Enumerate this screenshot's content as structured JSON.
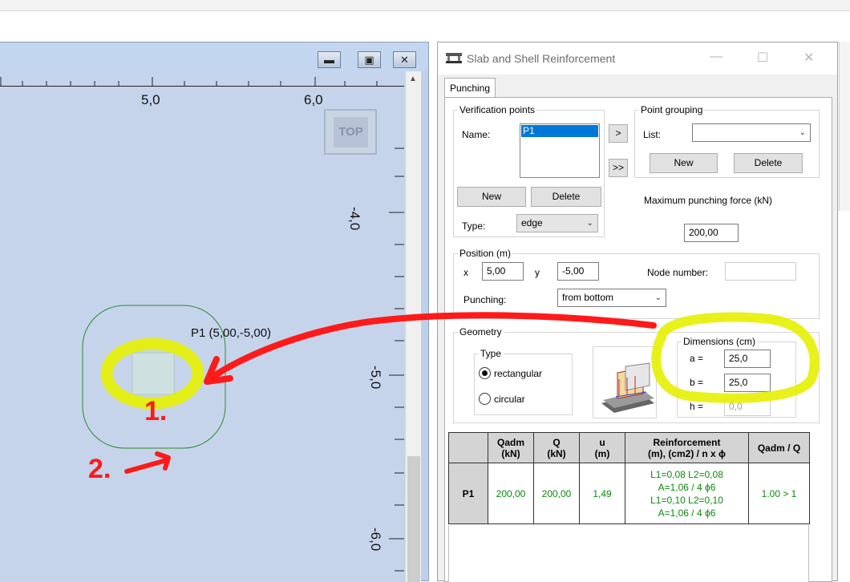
{
  "viewport": {
    "ruler_top": [
      "5,0",
      "6,0"
    ],
    "ruler_right": [
      "-4,0",
      "-5,0",
      "-6,0"
    ],
    "cube_label": "TOP",
    "point_label": "P1 (5,00,-5,00)"
  },
  "dialog": {
    "title": "Slab and Shell Reinforcement",
    "tab": "Punching",
    "verification": {
      "legend": "Verification points",
      "name_label": "Name:",
      "list_items": [
        "P1"
      ],
      "new_label": "New",
      "delete_label": "Delete",
      "type_label": "Type:",
      "type_value": "edge"
    },
    "move_one": ">",
    "move_all": ">>",
    "grouping": {
      "legend": "Point grouping",
      "list_label": "List:",
      "list_value": "",
      "new_label": "New",
      "delete_label": "Delete"
    },
    "max_force_label": "Maximum punching force (kN)",
    "max_force_value": "200,00",
    "position": {
      "legend": "Position (m)",
      "x_label": "x",
      "x_value": "5,00",
      "y_label": "y",
      "y_value": "-5,00",
      "node_label": "Node number:",
      "node_value": "",
      "punching_label": "Punching:",
      "punching_value": "from bottom"
    },
    "geometry": {
      "legend": "Geometry",
      "type_legend": "Type",
      "rect_label": "rectangular",
      "circ_label": "circular",
      "dims_legend": "Dimensions (cm)",
      "a_label": "a =",
      "a_value": "25,0",
      "b_label": "b =",
      "b_value": "25,0",
      "h_label": "h =",
      "h_value": "0,0"
    },
    "results": {
      "headers": [
        "",
        "Qadm\n(kN)",
        "Q\n(kN)",
        "u\n(m)",
        "Reinforcement\n(m), (cm2) / n x ϕ",
        "Qadm / Q"
      ],
      "row": {
        "name": "P1",
        "qadm": "200,00",
        "q": "200,00",
        "u": "1,49",
        "reinf": [
          "L1=0,08 L2=0,08",
          "A=1,06 / 4 ϕ6",
          "L1=0,10 L2=0,10",
          "A=1,06 / 4 ϕ6"
        ],
        "ratio": "1.00 > 1"
      }
    }
  },
  "annotations": {
    "label_1": "1.",
    "label_2": "2.",
    "highlight_color": "#e6f000",
    "arrow_color": "#ff1a1a"
  }
}
